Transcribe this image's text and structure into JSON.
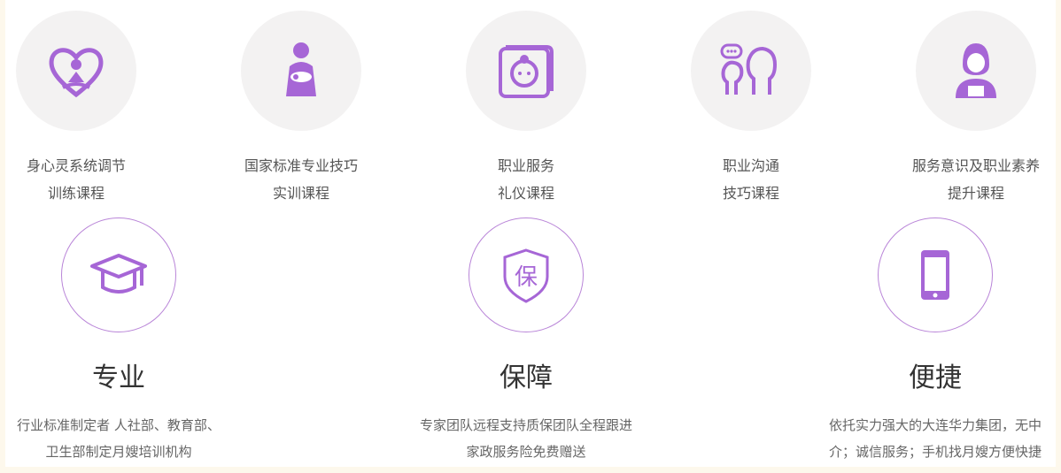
{
  "accent_color": "#a666d6",
  "courses": [
    {
      "icon": "meditation-heart-icon",
      "line1": "身心灵系统调节",
      "line2": "训练课程"
    },
    {
      "icon": "mother-baby-icon",
      "line1": "国家标准专业技巧",
      "line2": "实训课程"
    },
    {
      "icon": "baby-photo-icon",
      "line1": "职业服务",
      "line2": "礼仪课程"
    },
    {
      "icon": "communication-people-icon",
      "line1": "职业沟通",
      "line2": "技巧课程"
    },
    {
      "icon": "nanny-woman-icon",
      "line1": "服务意识及职业素养",
      "line2": "提升课程"
    }
  ],
  "features": [
    {
      "icon": "graduation-cap-icon",
      "title": "专业",
      "line1": "行业标准制定者 人社部、教育部、",
      "line2": "卫生部制定月嫂培训机构"
    },
    {
      "icon": "guarantee-shield-icon",
      "glyph": "保",
      "title": "保障",
      "line1": "专家团队远程支持质保团队全程跟进",
      "line2": "家政服务险免费赠送"
    },
    {
      "icon": "mobile-phone-icon",
      "title": "便捷",
      "line1": "依托实力强大的大连华力集团，无中",
      "line2": "介；诚信服务；手机找月嫂方便快捷"
    }
  ]
}
